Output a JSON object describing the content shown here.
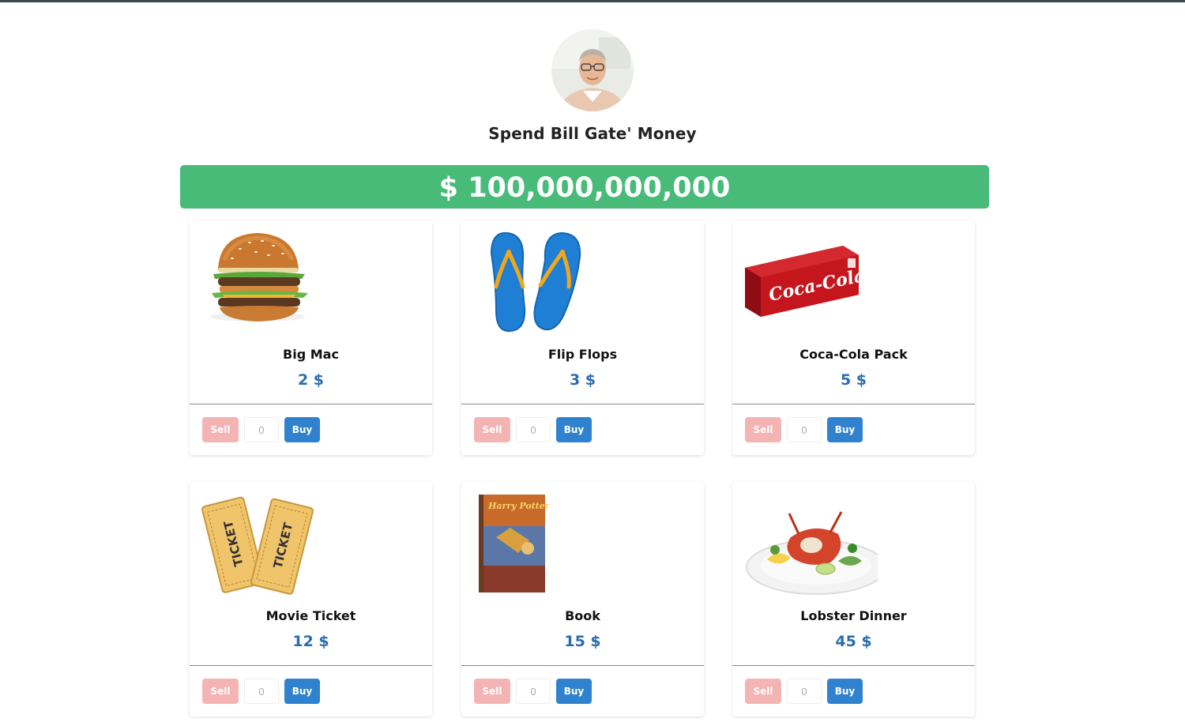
{
  "app": {
    "title": "Spend Bill Gate' Money",
    "avatar_alt": "Bill Gates"
  },
  "balance": {
    "text": "$ 100,000,000,000",
    "color": "#48bb78"
  },
  "colors": {
    "sell": "#f5b4b4",
    "buy": "#3182ce",
    "price": "#2b6cb0"
  },
  "products": [
    {
      "name": "Big Mac",
      "price": "2 $",
      "image_icon": "burger-image",
      "sell_label": "Sell",
      "buy_label": "Buy",
      "quantity": "0"
    },
    {
      "name": "Flip Flops",
      "price": "3 $",
      "image_icon": "flip-flops-image",
      "sell_label": "Sell",
      "buy_label": "Buy",
      "quantity": "0"
    },
    {
      "name": "Coca-Cola Pack",
      "price": "5 $",
      "image_icon": "coca-cola-pack-image",
      "image_text": "Coca-Cola",
      "sell_label": "Sell",
      "buy_label": "Buy",
      "quantity": "0"
    },
    {
      "name": "Movie Ticket",
      "price": "12 $",
      "image_icon": "movie-ticket-image",
      "image_text": "TICKET",
      "sell_label": "Sell",
      "buy_label": "Buy",
      "quantity": "0"
    },
    {
      "name": "Book",
      "price": "15 $",
      "image_icon": "book-image",
      "image_text": "Harry Potter",
      "sell_label": "Sell",
      "buy_label": "Buy",
      "quantity": "0"
    },
    {
      "name": "Lobster Dinner",
      "price": "45 $",
      "image_icon": "lobster-dinner-image",
      "sell_label": "Sell",
      "buy_label": "Buy",
      "quantity": "0"
    }
  ]
}
